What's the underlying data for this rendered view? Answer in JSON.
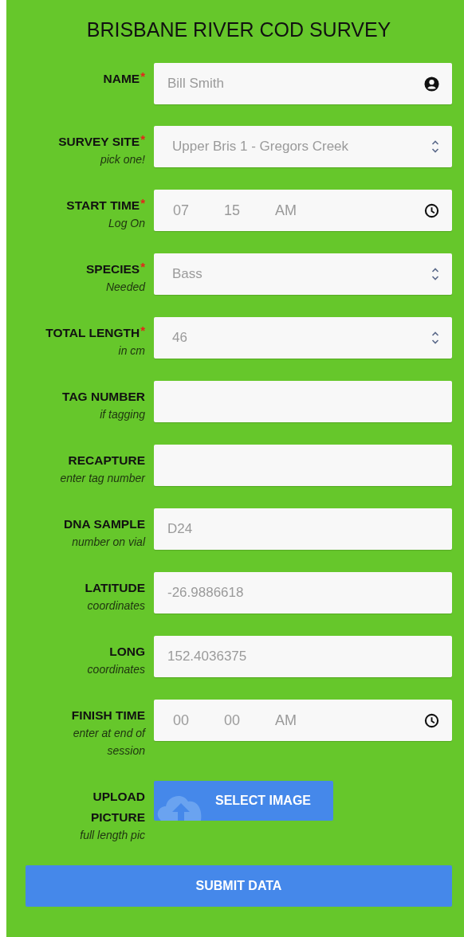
{
  "title": "BRISBANE RIVER COD SURVEY",
  "fields": [
    {
      "kind": "text",
      "label": "NAME",
      "required": "*",
      "value": "Bill Smith"
    },
    {
      "kind": "select",
      "label": "SURVEY SITE",
      "required": "*",
      "hint": "pick one!",
      "value": "Upper Bris 1 - Gregors Creek"
    },
    {
      "kind": "time",
      "label": "START TIME",
      "required": "*",
      "hint": "Log On",
      "parts": [
        "07",
        "15",
        "AM"
      ]
    },
    {
      "kind": "select",
      "label": "SPECIES",
      "required": "*",
      "hint": "Needed",
      "value": "Bass"
    },
    {
      "kind": "select",
      "label": "TOTAL LENGTH",
      "required": "*",
      "hint": "in cm",
      "value": "46"
    },
    {
      "kind": "text",
      "label": "TAG NUMBER",
      "hint": "if tagging"
    },
    {
      "kind": "text",
      "label": "RECAPTURE",
      "hint": "enter tag number"
    },
    {
      "kind": "text",
      "label": "DNA SAMPLE",
      "hint": "number on vial",
      "value": "D24"
    },
    {
      "kind": "text",
      "label": "LATITUDE",
      "hint": "coordinates",
      "value": "-26.9886618"
    },
    {
      "kind": "text",
      "label": "LONG",
      "hint": "coordinates",
      "value": "152.4036375"
    },
    {
      "kind": "time",
      "label": "FINISH TIME",
      "hint": "enter at end of session",
      "parts": [
        "00",
        "00",
        "AM"
      ]
    },
    {
      "kind": "upload",
      "label": "UPLOAD PICTURE",
      "hint": "full length pic",
      "button": "SELECT IMAGE"
    }
  ],
  "submit": "SUBMIT DATA"
}
